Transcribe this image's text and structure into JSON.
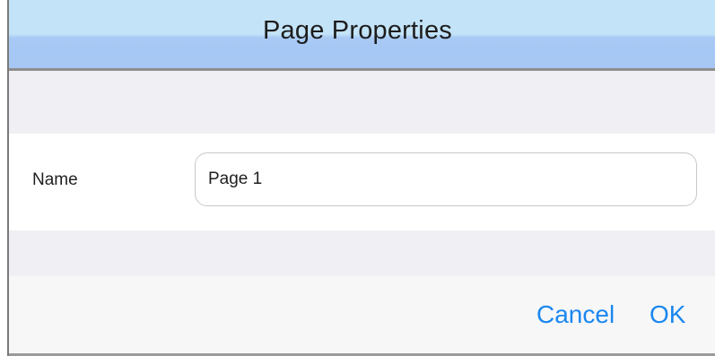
{
  "dialog": {
    "title": "Page Properties"
  },
  "form": {
    "name_label": "Name",
    "name_value": "Page 1"
  },
  "buttons": {
    "cancel_label": "Cancel",
    "ok_label": "OK"
  },
  "colors": {
    "title_bar": "#a6c7f3",
    "accent": "#1a87f0",
    "background": "#efeff4"
  }
}
